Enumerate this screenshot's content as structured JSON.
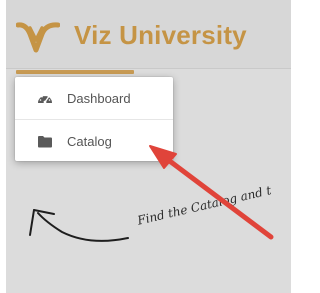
{
  "app": {
    "brand_name": "Viz University",
    "brand_color": "#c59445"
  },
  "menu": {
    "items": [
      {
        "label": "Dashboard",
        "icon": "dashboard-gauge-icon"
      },
      {
        "label": "Catalog",
        "icon": "folder-icon"
      }
    ]
  },
  "hint": {
    "text": "Find the Catalog and t"
  },
  "colors": {
    "annotation_arrow": "#e0443a",
    "background": "#dcdcdc"
  }
}
